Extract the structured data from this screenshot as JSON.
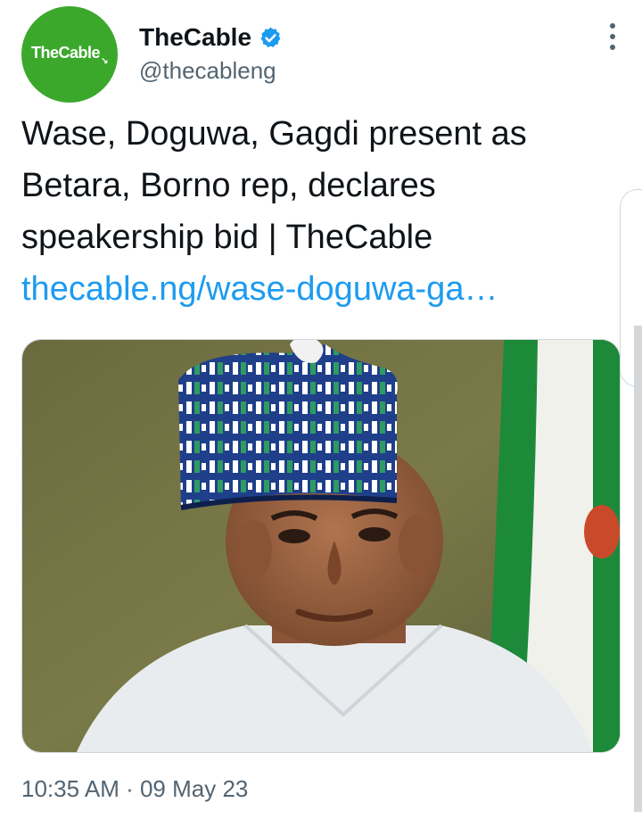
{
  "account": {
    "avatar_text": "TheCable",
    "display_name": "TheCable",
    "handle": "@thecableng",
    "brand_color": "#3ba82c",
    "verified_color": "#1d9bf0"
  },
  "tweet": {
    "text": "Wase, Doguwa, Gagdi present as Betara, Borno rep, declares speakership bid | TheCable",
    "link": "thecable.ng/wase-doguwa-ga…",
    "link_color": "#1d9bf0",
    "timestamp": "10:35 AM · 09 May 23"
  },
  "icons": {
    "verified": "verified-badge-icon",
    "more": "more-options-icon"
  }
}
